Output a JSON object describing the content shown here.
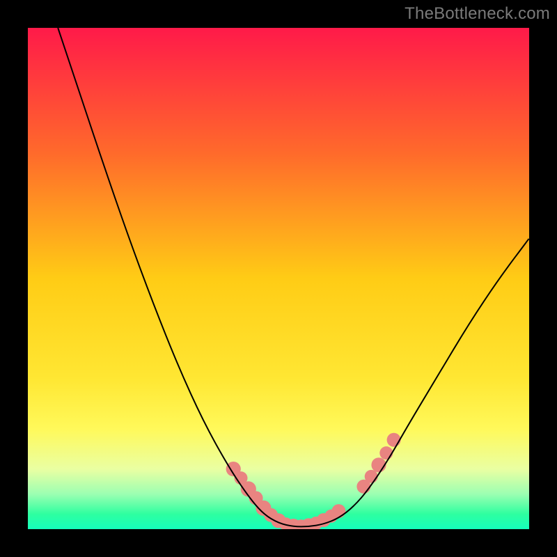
{
  "attribution": "TheBottleneck.com",
  "chart_data": {
    "type": "line",
    "title": "",
    "xlabel": "",
    "ylabel": "",
    "x_range": [
      0,
      100
    ],
    "y_range": [
      0,
      100
    ],
    "grid": false,
    "legend": false,
    "background_gradient": {
      "stops": [
        {
          "offset": 0.0,
          "color": "#ff1a49"
        },
        {
          "offset": 0.25,
          "color": "#ff6a2b"
        },
        {
          "offset": 0.5,
          "color": "#ffcc15"
        },
        {
          "offset": 0.7,
          "color": "#ffe733"
        },
        {
          "offset": 0.8,
          "color": "#fff95a"
        },
        {
          "offset": 0.88,
          "color": "#eaffa2"
        },
        {
          "offset": 0.93,
          "color": "#9cffb2"
        },
        {
          "offset": 0.97,
          "color": "#2effa0"
        },
        {
          "offset": 1.0,
          "color": "#15ffbc"
        }
      ]
    },
    "series": [
      {
        "name": "curve",
        "color": "#000000",
        "points": [
          {
            "x": 6.0,
            "y": 100.0
          },
          {
            "x": 10.0,
            "y": 88.0
          },
          {
            "x": 15.0,
            "y": 73.0
          },
          {
            "x": 20.0,
            "y": 58.5
          },
          {
            "x": 25.0,
            "y": 45.0
          },
          {
            "x": 30.0,
            "y": 32.5
          },
          {
            "x": 35.0,
            "y": 21.5
          },
          {
            "x": 40.0,
            "y": 12.5
          },
          {
            "x": 44.0,
            "y": 6.5
          },
          {
            "x": 47.0,
            "y": 3.0
          },
          {
            "x": 50.0,
            "y": 1.2
          },
          {
            "x": 53.0,
            "y": 0.5
          },
          {
            "x": 56.0,
            "y": 0.5
          },
          {
            "x": 59.0,
            "y": 1.0
          },
          {
            "x": 62.0,
            "y": 2.2
          },
          {
            "x": 65.0,
            "y": 4.5
          },
          {
            "x": 68.0,
            "y": 8.0
          },
          {
            "x": 72.0,
            "y": 14.0
          },
          {
            "x": 76.0,
            "y": 21.0
          },
          {
            "x": 82.0,
            "y": 31.0
          },
          {
            "x": 88.0,
            "y": 41.0
          },
          {
            "x": 94.0,
            "y": 50.0
          },
          {
            "x": 100.0,
            "y": 58.0
          }
        ]
      }
    ],
    "markers": [
      {
        "x": 41.0,
        "y": 12.0,
        "r": 1.3
      },
      {
        "x": 42.5,
        "y": 10.2,
        "r": 1.1
      },
      {
        "x": 44.0,
        "y": 8.0,
        "r": 1.4
      },
      {
        "x": 45.5,
        "y": 6.2,
        "r": 1.2
      },
      {
        "x": 47.0,
        "y": 4.2,
        "r": 1.4
      },
      {
        "x": 48.5,
        "y": 2.8,
        "r": 1.2
      },
      {
        "x": 50.0,
        "y": 1.7,
        "r": 1.3
      },
      {
        "x": 51.5,
        "y": 1.0,
        "r": 1.1
      },
      {
        "x": 53.0,
        "y": 0.7,
        "r": 1.2
      },
      {
        "x": 54.5,
        "y": 0.6,
        "r": 1.1
      },
      {
        "x": 56.0,
        "y": 0.8,
        "r": 1.2
      },
      {
        "x": 57.5,
        "y": 1.2,
        "r": 1.1
      },
      {
        "x": 59.0,
        "y": 1.8,
        "r": 1.2
      },
      {
        "x": 60.5,
        "y": 2.6,
        "r": 1.1
      },
      {
        "x": 62.0,
        "y": 3.6,
        "r": 1.2
      },
      {
        "x": 67.0,
        "y": 8.5,
        "r": 1.2
      },
      {
        "x": 68.5,
        "y": 10.5,
        "r": 1.1
      },
      {
        "x": 70.0,
        "y": 12.8,
        "r": 1.3
      },
      {
        "x": 71.5,
        "y": 15.2,
        "r": 1.1
      },
      {
        "x": 73.0,
        "y": 17.8,
        "r": 1.2
      }
    ],
    "marker_color": "#e98481",
    "frame_color": "#000000",
    "frame_width_pct": 5.0
  }
}
